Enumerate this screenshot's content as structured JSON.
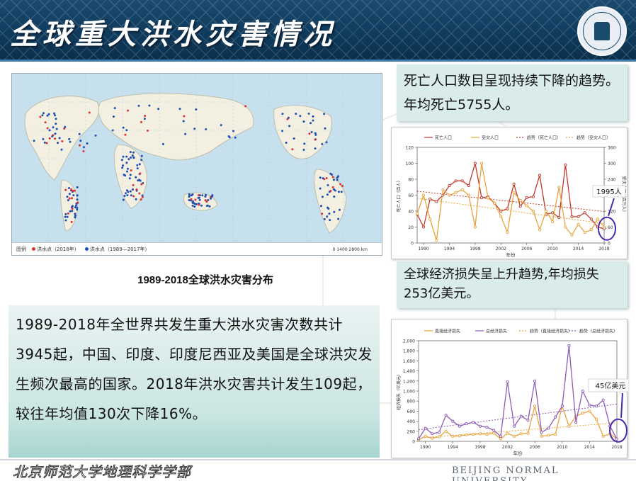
{
  "header": {
    "title": "全球重大洪水灾害情况",
    "colors": {
      "band": "#0e3a5c",
      "accent": "#3b7bb0"
    },
    "logo_icon": "university-seal-icon"
  },
  "map": {
    "caption": "1989-2018全球洪水灾害分布",
    "legend_label": "图例",
    "legend_items": [
      {
        "label": "洪水点（2018年）",
        "color": "#e0312f"
      },
      {
        "label": "洪水点（1989—2017年）",
        "color": "#1d4fb3"
      }
    ],
    "scale_label": "0  1400  2800 km"
  },
  "info": {
    "text": "1989-2018年全世界共发生重大洪水灾害次数共计3945起，中国、印度、印度尼西亚及美国是全球洪灾发生频次最高的国家。2018年洪水灾害共计发生109起，较往年均值130次下降16%。"
  },
  "box1": {
    "text": "死亡人口数目呈现持续下降的趋势。年均死亡5755人。"
  },
  "box2": {
    "text": "全球经济损失呈上升趋势,年均损失253亿美元。"
  },
  "chart_data": [
    {
      "type": "line",
      "x": [
        1989,
        1990,
        1991,
        1992,
        1993,
        1994,
        1995,
        1996,
        1997,
        1998,
        1999,
        2000,
        2001,
        2002,
        2003,
        2004,
        2005,
        2006,
        2007,
        2008,
        2009,
        2010,
        2011,
        2012,
        2013,
        2014,
        2015,
        2016,
        2017,
        2018
      ],
      "series": [
        {
          "name": "死亡人口",
          "axis": "left",
          "color": "#c0392b",
          "values": [
            36,
            20,
            55,
            52,
            60,
            72,
            78,
            78,
            72,
            100,
            57,
            58,
            50,
            40,
            43,
            74,
            46,
            57,
            58,
            85,
            36,
            38,
            32,
            98,
            33,
            33,
            38,
            30,
            20,
            18
          ]
        },
        {
          "name": "受灾人口",
          "axis": "right",
          "color": "#e8a33d",
          "values": [
            110,
            180,
            90,
            10,
            200,
            180,
            190,
            200,
            180,
            60,
            300,
            170,
            150,
            100,
            40,
            190,
            160,
            140,
            120,
            50,
            120,
            80,
            210,
            60,
            30,
            70,
            40,
            50,
            90,
            60
          ]
        }
      ],
      "legend": [
        "死亡人口",
        "受灾人口",
        "趋势（死亡人口）",
        "趋势（受灾人口）"
      ],
      "ylabel_left": "死亡人口（百人）",
      "ylabel_right": "受灾人口（百万人）",
      "xlabel": "年份",
      "ylim_left": [
        0,
        120
      ],
      "ylim_right": [
        0,
        360
      ],
      "x_ticks": [
        1990,
        1994,
        1998,
        2002,
        2006,
        2010,
        2014,
        2018
      ],
      "y_ticks_left": [
        0,
        20,
        40,
        60,
        80,
        100,
        120
      ],
      "y_ticks_right": [
        0,
        60,
        120,
        180,
        240,
        300,
        360
      ],
      "annotation": "1995人"
    },
    {
      "type": "line",
      "x": [
        1989,
        1990,
        1991,
        1992,
        1993,
        1994,
        1995,
        1996,
        1997,
        1998,
        1999,
        2000,
        2001,
        2002,
        2003,
        2004,
        2005,
        2006,
        2007,
        2008,
        2009,
        2010,
        2011,
        2012,
        2013,
        2014,
        2015,
        2016,
        2017,
        2018
      ],
      "series": [
        {
          "name": "直接经济损失",
          "color": "#e8a33d",
          "values": [
            30,
            100,
            60,
            90,
            200,
            100,
            110,
            130,
            140,
            150,
            140,
            160,
            50,
            160,
            100,
            150,
            160,
            700,
            100,
            120,
            140,
            700,
            300,
            500,
            560,
            600,
            440,
            100,
            150,
            45
          ]
        },
        {
          "name": "总经济损失",
          "color": "#8e5bb8",
          "values": [
            50,
            260,
            150,
            180,
            520,
            400,
            300,
            350,
            380,
            300,
            280,
            220,
            100,
            1180,
            300,
            500,
            420,
            1200,
            180,
            260,
            480,
            700,
            1900,
            380,
            1000,
            720,
            700,
            820,
            300,
            45
          ]
        }
      ],
      "legend": [
        "直接经济损失",
        "总经济损失",
        "趋势（直接经济损失）",
        "趋势（总经济损失）"
      ],
      "ylabel": "经济损失（亿美元）",
      "xlabel": "年份",
      "ylim": [
        0,
        2000
      ],
      "x_ticks": [
        1990,
        1994,
        1998,
        2002,
        2006,
        2010,
        2014,
        2018
      ],
      "y_ticks": [
        0,
        200,
        400,
        600,
        800,
        1000,
        1200,
        1400,
        1600,
        1800,
        2000
      ],
      "annotation": "45亿美元"
    }
  ],
  "footer": {
    "left": "北京师范大学地理科学学部",
    "right": "BEIJING NORMAL UNIVERSITY"
  }
}
